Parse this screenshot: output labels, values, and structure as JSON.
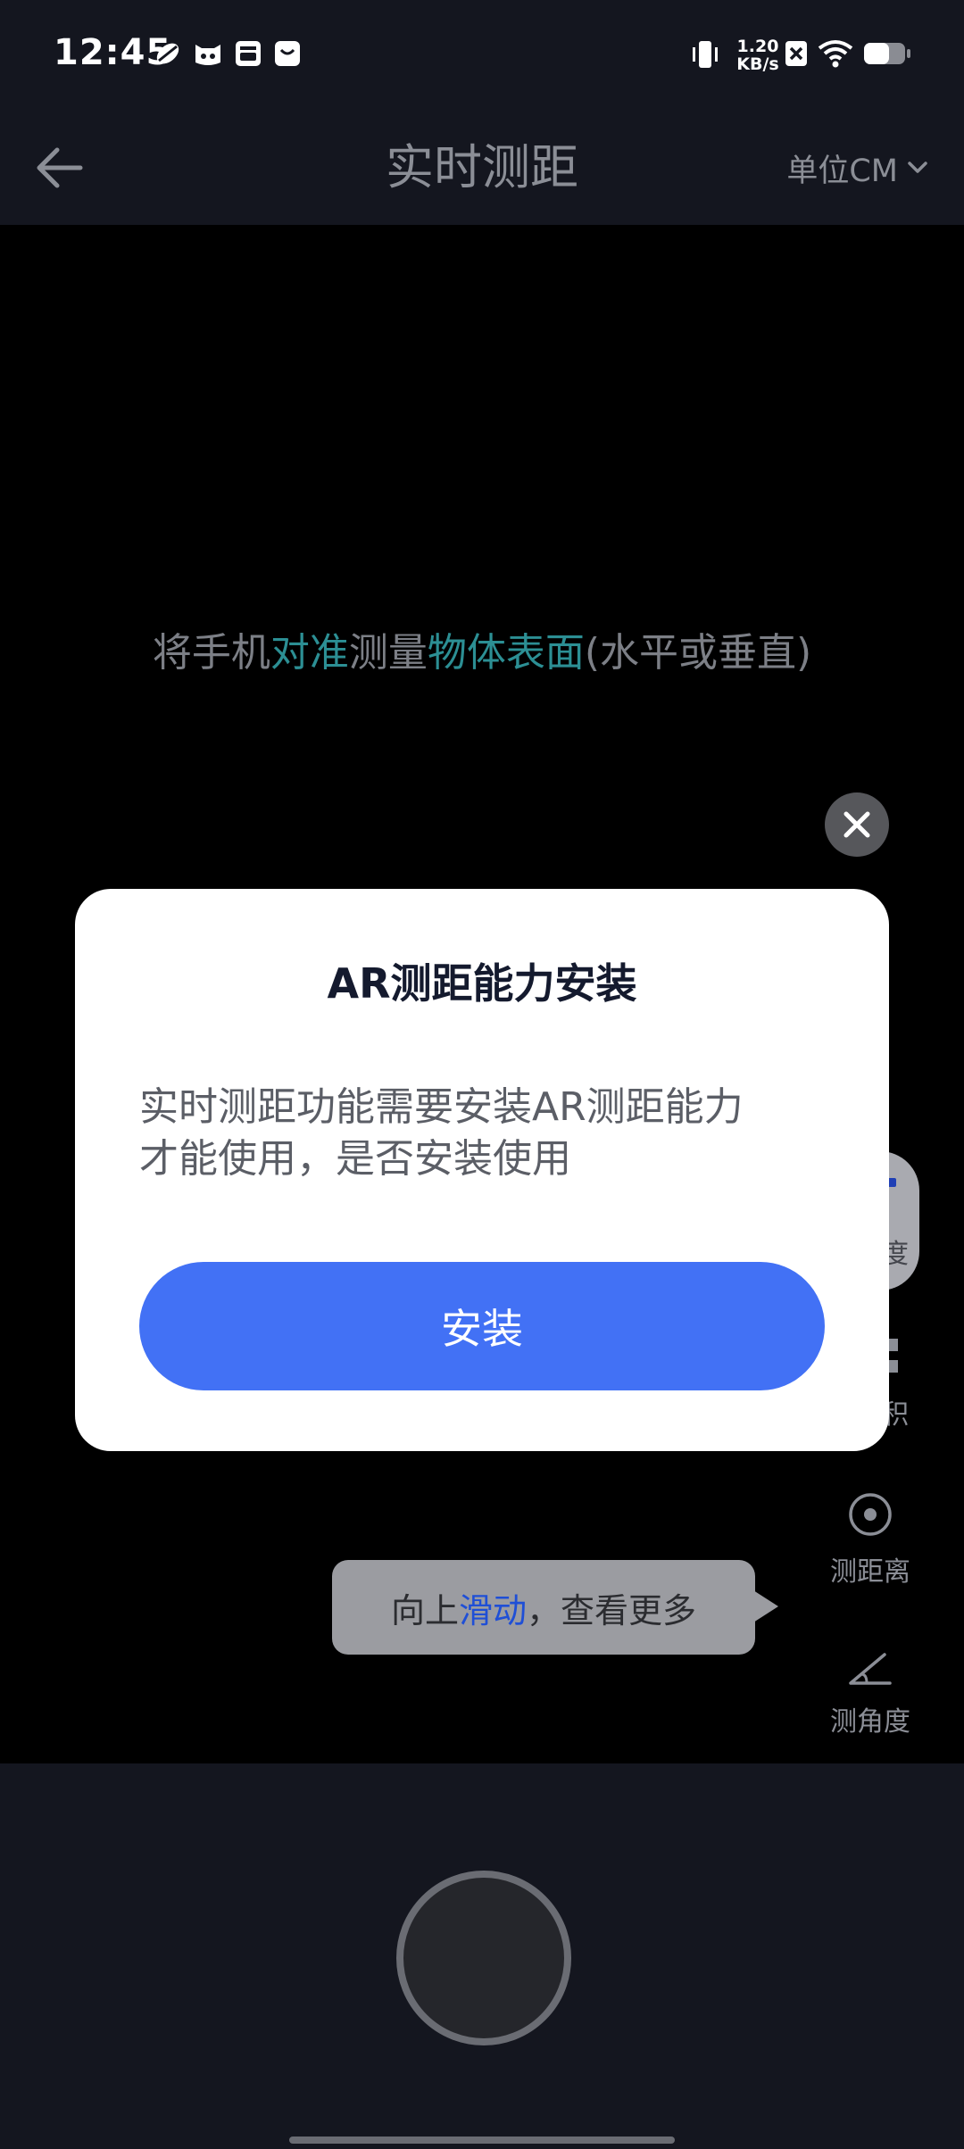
{
  "status_bar": {
    "time": "12:45",
    "net_speed_value": "1.20",
    "net_speed_unit": "KB/s",
    "icons": [
      "leaf-icon",
      "cat-face-icon",
      "inbox-icon",
      "chat-bag-icon",
      "vibrate-icon",
      "no-sim-icon",
      "wifi-icon",
      "battery-icon"
    ]
  },
  "header": {
    "title": "实时测距",
    "unit_label": "单位CM",
    "back_icon": "arrow-left-icon",
    "unit_dropdown_icon": "chevron-down-icon"
  },
  "camera": {
    "hint_parts": [
      "将手机",
      "对准",
      "测量",
      "物体表面",
      "(水平或垂直)"
    ],
    "highlight_color": "#2c8f94"
  },
  "side_tools": [
    {
      "label": "度"
    },
    {
      "label": "积"
    },
    {
      "label": "测距离"
    },
    {
      "label": "测角度"
    }
  ],
  "swipe_tooltip": {
    "part1": "向上",
    "highlight": "滑动",
    "part2": "，查看更多"
  },
  "dialog": {
    "title": "AR测距能力安装",
    "message_line1": "实时测距功能需要安装AR测距能力",
    "message_line2": "才能使用，是否安装使用",
    "install_label": "安装",
    "button_color": "#4271f5",
    "close_icon": "close-icon"
  },
  "bottom": {
    "shutter_icon": "shutter-button"
  }
}
